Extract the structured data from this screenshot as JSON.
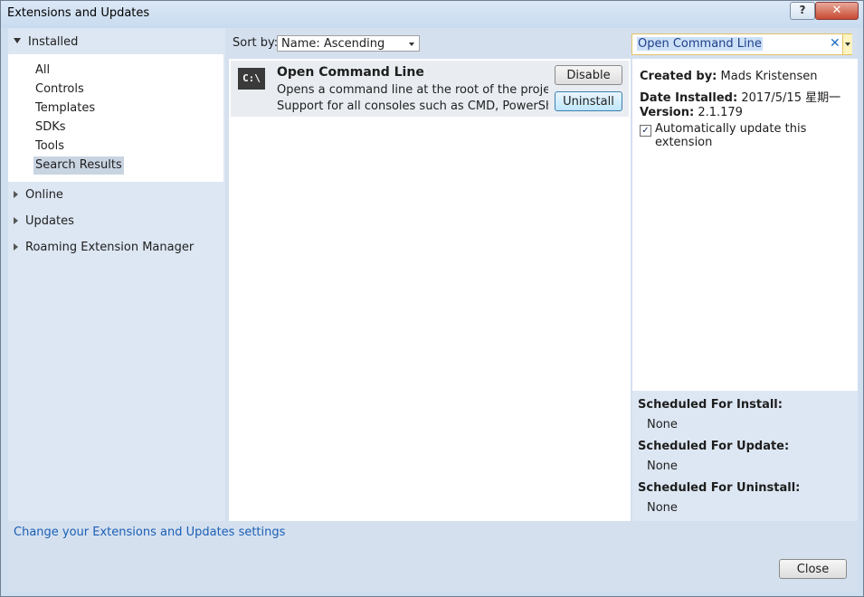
{
  "window": {
    "title": "Extensions and Updates",
    "help_label": "?",
    "close_label": "✕"
  },
  "nav": {
    "installed_label": "Installed",
    "items": [
      {
        "label": "All"
      },
      {
        "label": "Controls"
      },
      {
        "label": "Templates"
      },
      {
        "label": "SDKs"
      },
      {
        "label": "Tools"
      },
      {
        "label": "Search Results",
        "selected": true
      }
    ],
    "sections": [
      {
        "label": "Online"
      },
      {
        "label": "Updates"
      },
      {
        "label": "Roaming Extension Manager"
      }
    ]
  },
  "sort": {
    "label": "Sort by:",
    "value": "Name: Ascending"
  },
  "search": {
    "value": "Open Command Line",
    "clear_icon": "✕"
  },
  "extension": {
    "icon_text": "C:\\",
    "name": "Open Command Line",
    "description_line1": "Opens a command line at the root of the project.",
    "description_line2": "Support for all consoles such as CMD, PowerShe…",
    "disable_label": "Disable",
    "uninstall_label": "Uninstall"
  },
  "details": {
    "created_by_label": "Created by:",
    "created_by_value": "Mads Kristensen",
    "date_installed_label": "Date Installed:",
    "date_installed_value": "2017/5/15 星期一",
    "version_label": "Version:",
    "version_value": "2.1.179",
    "auto_update_label": "Automatically update this extension",
    "auto_update_checked": true,
    "check_glyph": "✓"
  },
  "scheduled": {
    "install_label": "Scheduled For Install:",
    "install_value": "None",
    "update_label": "Scheduled For Update:",
    "update_value": "None",
    "uninstall_label": "Scheduled For Uninstall:",
    "uninstall_value": "None"
  },
  "footer": {
    "settings_link": "Change your Extensions and Updates settings",
    "close_label": "Close"
  }
}
